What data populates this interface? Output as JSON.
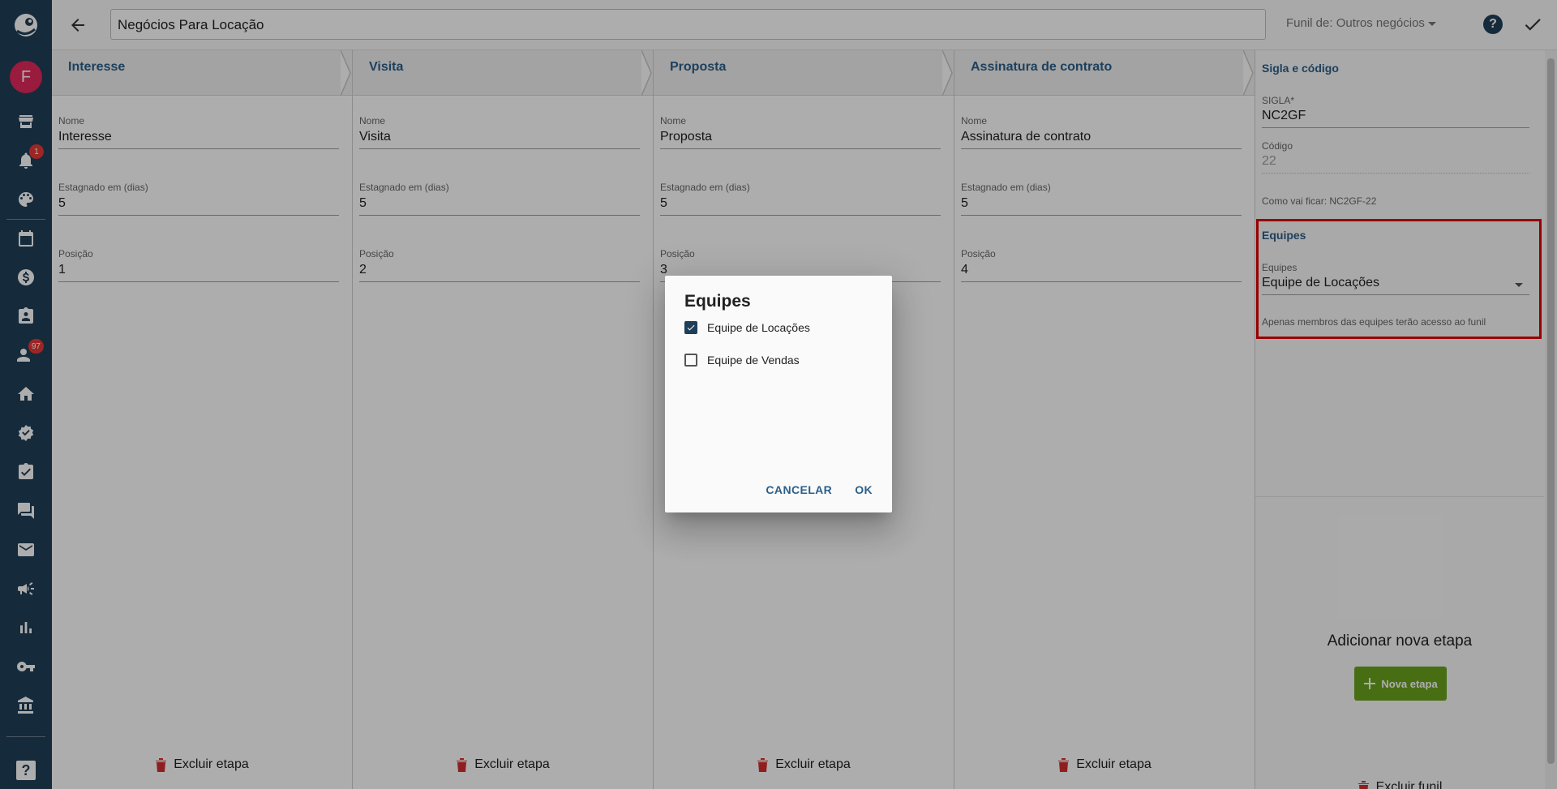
{
  "header": {
    "title_value": "Negócios Para Locação",
    "funnel_label": "Funil de: Outros negócios"
  },
  "sidebar": {
    "avatar_letter": "F",
    "notifications_badge": "1",
    "contacts_badge": "97"
  },
  "stages": [
    {
      "title": "Interesse",
      "name_label": "Nome",
      "name_value": "Interesse",
      "stagnant_label": "Estagnado em (dias)",
      "stagnant_value": "5",
      "position_label": "Posição",
      "position_value": "1",
      "delete_label": "Excluir etapa"
    },
    {
      "title": "Visita",
      "name_label": "Nome",
      "name_value": "Visita",
      "stagnant_label": "Estagnado em (dias)",
      "stagnant_value": "5",
      "position_label": "Posição",
      "position_value": "2",
      "delete_label": "Excluir etapa"
    },
    {
      "title": "Proposta",
      "name_label": "Nome",
      "name_value": "Proposta",
      "stagnant_label": "Estagnado em (dias)",
      "stagnant_value": "5",
      "position_label": "Posição",
      "position_value": "3",
      "delete_label": "Excluir etapa"
    },
    {
      "title": "Assinatura de contrato",
      "name_label": "Nome",
      "name_value": "Assinatura de contrato",
      "stagnant_label": "Estagnado em (dias)",
      "stagnant_value": "5",
      "position_label": "Posição",
      "position_value": "4",
      "delete_label": "Excluir etapa"
    }
  ],
  "right_panel": {
    "code_section_title": "Sigla e código",
    "sigla_label": "SIGLA*",
    "sigla_value": "NC2GF",
    "codigo_label": "Código",
    "codigo_value": "22",
    "preview_text": "Como vai ficar:  NC2GF-22",
    "teams_section_title": "Equipes",
    "teams_label": "Equipes",
    "teams_value": "Equipe de Locações",
    "teams_hint": "Apenas membros das equipes terão acesso ao funil",
    "add_stage_title": "Adicionar nova etapa",
    "new_stage_button": "Nova etapa",
    "delete_funnel": "Excluir funil"
  },
  "dialog": {
    "title": "Equipes",
    "options": [
      {
        "label": "Equipe de Locações",
        "checked": true
      },
      {
        "label": "Equipe de Vendas",
        "checked": false
      }
    ],
    "cancel_label": "CANCELAR",
    "ok_label": "OK"
  },
  "colors": {
    "sidebar": "#1f3e58",
    "accent": "#2b5f8a",
    "highlight": "#e00000",
    "success": "#6aa31e",
    "danger": "#d32f2f"
  }
}
